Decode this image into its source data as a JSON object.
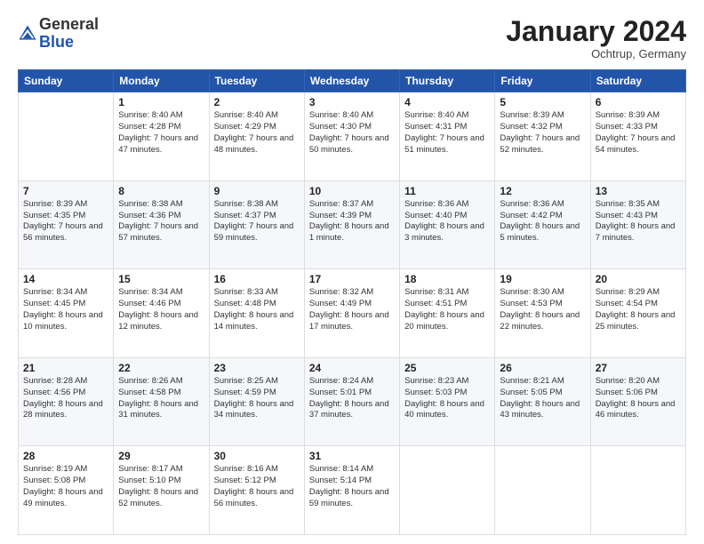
{
  "header": {
    "logo": {
      "general": "General",
      "blue": "Blue"
    },
    "title": "January 2024",
    "location": "Ochtrup, Germany"
  },
  "calendar": {
    "headers": [
      "Sunday",
      "Monday",
      "Tuesday",
      "Wednesday",
      "Thursday",
      "Friday",
      "Saturday"
    ],
    "weeks": [
      [
        {
          "day": "",
          "info": ""
        },
        {
          "day": "1",
          "info": "Sunrise: 8:40 AM\nSunset: 4:28 PM\nDaylight: 7 hours\nand 47 minutes."
        },
        {
          "day": "2",
          "info": "Sunrise: 8:40 AM\nSunset: 4:29 PM\nDaylight: 7 hours\nand 48 minutes."
        },
        {
          "day": "3",
          "info": "Sunrise: 8:40 AM\nSunset: 4:30 PM\nDaylight: 7 hours\nand 50 minutes."
        },
        {
          "day": "4",
          "info": "Sunrise: 8:40 AM\nSunset: 4:31 PM\nDaylight: 7 hours\nand 51 minutes."
        },
        {
          "day": "5",
          "info": "Sunrise: 8:39 AM\nSunset: 4:32 PM\nDaylight: 7 hours\nand 52 minutes."
        },
        {
          "day": "6",
          "info": "Sunrise: 8:39 AM\nSunset: 4:33 PM\nDaylight: 7 hours\nand 54 minutes."
        }
      ],
      [
        {
          "day": "7",
          "info": "Sunrise: 8:39 AM\nSunset: 4:35 PM\nDaylight: 7 hours\nand 56 minutes."
        },
        {
          "day": "8",
          "info": "Sunrise: 8:38 AM\nSunset: 4:36 PM\nDaylight: 7 hours\nand 57 minutes."
        },
        {
          "day": "9",
          "info": "Sunrise: 8:38 AM\nSunset: 4:37 PM\nDaylight: 7 hours\nand 59 minutes."
        },
        {
          "day": "10",
          "info": "Sunrise: 8:37 AM\nSunset: 4:39 PM\nDaylight: 8 hours\nand 1 minute."
        },
        {
          "day": "11",
          "info": "Sunrise: 8:36 AM\nSunset: 4:40 PM\nDaylight: 8 hours\nand 3 minutes."
        },
        {
          "day": "12",
          "info": "Sunrise: 8:36 AM\nSunset: 4:42 PM\nDaylight: 8 hours\nand 5 minutes."
        },
        {
          "day": "13",
          "info": "Sunrise: 8:35 AM\nSunset: 4:43 PM\nDaylight: 8 hours\nand 7 minutes."
        }
      ],
      [
        {
          "day": "14",
          "info": "Sunrise: 8:34 AM\nSunset: 4:45 PM\nDaylight: 8 hours\nand 10 minutes."
        },
        {
          "day": "15",
          "info": "Sunrise: 8:34 AM\nSunset: 4:46 PM\nDaylight: 8 hours\nand 12 minutes."
        },
        {
          "day": "16",
          "info": "Sunrise: 8:33 AM\nSunset: 4:48 PM\nDaylight: 8 hours\nand 14 minutes."
        },
        {
          "day": "17",
          "info": "Sunrise: 8:32 AM\nSunset: 4:49 PM\nDaylight: 8 hours\nand 17 minutes."
        },
        {
          "day": "18",
          "info": "Sunrise: 8:31 AM\nSunset: 4:51 PM\nDaylight: 8 hours\nand 20 minutes."
        },
        {
          "day": "19",
          "info": "Sunrise: 8:30 AM\nSunset: 4:53 PM\nDaylight: 8 hours\nand 22 minutes."
        },
        {
          "day": "20",
          "info": "Sunrise: 8:29 AM\nSunset: 4:54 PM\nDaylight: 8 hours\nand 25 minutes."
        }
      ],
      [
        {
          "day": "21",
          "info": "Sunrise: 8:28 AM\nSunset: 4:56 PM\nDaylight: 8 hours\nand 28 minutes."
        },
        {
          "day": "22",
          "info": "Sunrise: 8:26 AM\nSunset: 4:58 PM\nDaylight: 8 hours\nand 31 minutes."
        },
        {
          "day": "23",
          "info": "Sunrise: 8:25 AM\nSunset: 4:59 PM\nDaylight: 8 hours\nand 34 minutes."
        },
        {
          "day": "24",
          "info": "Sunrise: 8:24 AM\nSunset: 5:01 PM\nDaylight: 8 hours\nand 37 minutes."
        },
        {
          "day": "25",
          "info": "Sunrise: 8:23 AM\nSunset: 5:03 PM\nDaylight: 8 hours\nand 40 minutes."
        },
        {
          "day": "26",
          "info": "Sunrise: 8:21 AM\nSunset: 5:05 PM\nDaylight: 8 hours\nand 43 minutes."
        },
        {
          "day": "27",
          "info": "Sunrise: 8:20 AM\nSunset: 5:06 PM\nDaylight: 8 hours\nand 46 minutes."
        }
      ],
      [
        {
          "day": "28",
          "info": "Sunrise: 8:19 AM\nSunset: 5:08 PM\nDaylight: 8 hours\nand 49 minutes."
        },
        {
          "day": "29",
          "info": "Sunrise: 8:17 AM\nSunset: 5:10 PM\nDaylight: 8 hours\nand 52 minutes."
        },
        {
          "day": "30",
          "info": "Sunrise: 8:16 AM\nSunset: 5:12 PM\nDaylight: 8 hours\nand 56 minutes."
        },
        {
          "day": "31",
          "info": "Sunrise: 8:14 AM\nSunset: 5:14 PM\nDaylight: 8 hours\nand 59 minutes."
        },
        {
          "day": "",
          "info": ""
        },
        {
          "day": "",
          "info": ""
        },
        {
          "day": "",
          "info": ""
        }
      ]
    ]
  }
}
